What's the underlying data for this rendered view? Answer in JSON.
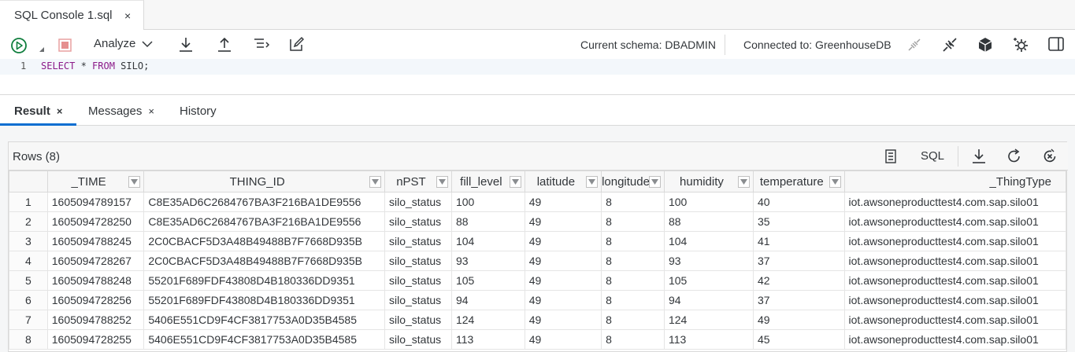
{
  "editor_tab": {
    "title": "SQL Console 1.sql",
    "close": "×"
  },
  "toolbar": {
    "analyze_label": "Analyze",
    "current_schema": "Current schema: DBADMIN",
    "connected_to": "Connected to: GreenhouseDB"
  },
  "editor": {
    "line_number": "1",
    "code": [
      {
        "text": "SELECT",
        "kw": true
      },
      {
        "text": " * ",
        "kw": false
      },
      {
        "text": "FROM",
        "kw": true
      },
      {
        "text": " SILO;",
        "kw": false
      }
    ]
  },
  "result_tabs": [
    {
      "label": "Result",
      "closable": true,
      "active": true
    },
    {
      "label": "Messages",
      "closable": true,
      "active": false
    },
    {
      "label": "History",
      "closable": false,
      "active": false
    }
  ],
  "result": {
    "rows_label": "Rows (8)",
    "sql_button": "SQL",
    "columns": [
      "_TIME",
      "THING_ID",
      "nPST",
      "fill_level",
      "latitude",
      "longitude",
      "humidity",
      "temperature",
      "_ThingType"
    ],
    "rows": [
      [
        "1",
        "1605094789157",
        "C8E35AD6C2684767BA3F216BA1DE9556",
        "silo_status",
        "100",
        "49",
        "8",
        "100",
        "40",
        "iot.awsoneproducttest4.com.sap.silo01"
      ],
      [
        "2",
        "1605094728250",
        "C8E35AD6C2684767BA3F216BA1DE9556",
        "silo_status",
        "88",
        "49",
        "8",
        "88",
        "35",
        "iot.awsoneproducttest4.com.sap.silo01"
      ],
      [
        "3",
        "1605094788245",
        "2C0CBACF5D3A48B49488B7F7668D935B",
        "silo_status",
        "104",
        "49",
        "8",
        "104",
        "41",
        "iot.awsoneproducttest4.com.sap.silo01"
      ],
      [
        "4",
        "1605094728267",
        "2C0CBACF5D3A48B49488B7F7668D935B",
        "silo_status",
        "93",
        "49",
        "8",
        "93",
        "37",
        "iot.awsoneproducttest4.com.sap.silo01"
      ],
      [
        "5",
        "1605094788248",
        "55201F689FDF43808D4B180336DD9351",
        "silo_status",
        "105",
        "49",
        "8",
        "105",
        "42",
        "iot.awsoneproducttest4.com.sap.silo01"
      ],
      [
        "6",
        "1605094728256",
        "55201F689FDF43808D4B180336DD9351",
        "silo_status",
        "94",
        "49",
        "8",
        "94",
        "37",
        "iot.awsoneproducttest4.com.sap.silo01"
      ],
      [
        "7",
        "1605094788252",
        "5406E551CD9F4CF3817753A0D35B4585",
        "silo_status",
        "124",
        "49",
        "8",
        "124",
        "49",
        "iot.awsoneproducttest4.com.sap.silo01"
      ],
      [
        "8",
        "1605094728255",
        "5406E551CD9F4CF3817753A0D35B4585",
        "silo_status",
        "113",
        "49",
        "8",
        "113",
        "45",
        "iot.awsoneproducttest4.com.sap.silo01"
      ]
    ]
  },
  "colors": {
    "accent": "#0a6ed1",
    "run_green": "#107e3e",
    "stop_red": "#d9534f",
    "keyword": "#8b1a89"
  }
}
